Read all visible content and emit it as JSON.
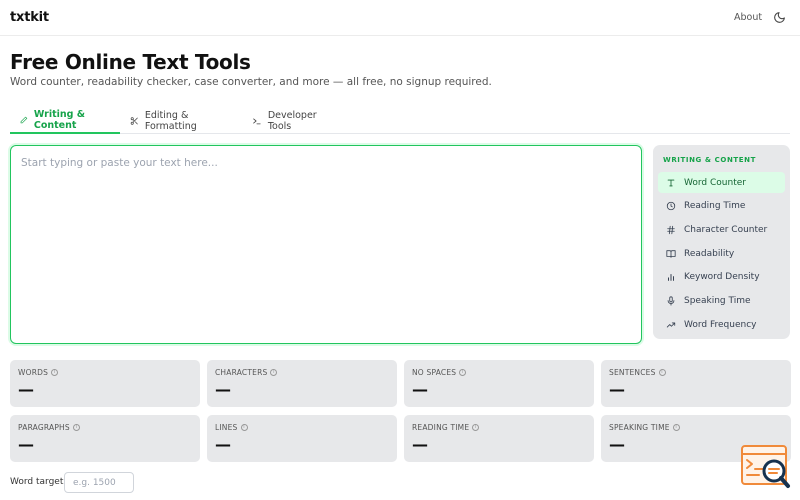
{
  "header": {
    "logo": "txtkit",
    "about_label": "About",
    "theme_icon": "moon-icon"
  },
  "hero": {
    "title": "Free Online Text Tools",
    "subtitle": "Word counter, readability checker, case converter, and more — all free, no signup required."
  },
  "tabs": [
    {
      "label": "Writing & Content",
      "icon": "pencil-icon",
      "active": true
    },
    {
      "label": "Editing & Formatting",
      "icon": "scissors-icon",
      "active": false
    },
    {
      "label": "Developer Tools",
      "icon": "terminal-icon",
      "active": false
    }
  ],
  "editor": {
    "placeholder": "Start typing or paste your text here...",
    "value": ""
  },
  "sidebar": {
    "heading": "WRITING & CONTENT",
    "items": [
      {
        "label": "Word Counter",
        "icon": "type-icon",
        "active": true
      },
      {
        "label": "Reading Time",
        "icon": "clock-icon",
        "active": false
      },
      {
        "label": "Character Counter",
        "icon": "hash-icon",
        "active": false
      },
      {
        "label": "Readability",
        "icon": "book-icon",
        "active": false
      },
      {
        "label": "Keyword Density",
        "icon": "bar-chart-icon",
        "active": false
      },
      {
        "label": "Speaking Time",
        "icon": "microphone-icon",
        "active": false
      },
      {
        "label": "Word Frequency",
        "icon": "trend-icon",
        "active": false
      }
    ]
  },
  "stats": [
    {
      "label": "WORDS",
      "value": "—"
    },
    {
      "label": "CHARACTERS",
      "value": "—"
    },
    {
      "label": "NO SPACES",
      "value": "—"
    },
    {
      "label": "SENTENCES",
      "value": "—"
    },
    {
      "label": "PARAGRAPHS",
      "value": "—"
    },
    {
      "label": "LINES",
      "value": "—"
    },
    {
      "label": "READING TIME",
      "value": "—"
    },
    {
      "label": "SPEAKING TIME",
      "value": "—"
    }
  ],
  "word_target": {
    "label": "Word target",
    "placeholder": "e.g. 1500",
    "value": ""
  },
  "colors": {
    "accent": "#22c55e",
    "accent_text": "#16a34a",
    "card_bg": "#e7e8ea",
    "active_item_bg": "#dcfce7"
  }
}
